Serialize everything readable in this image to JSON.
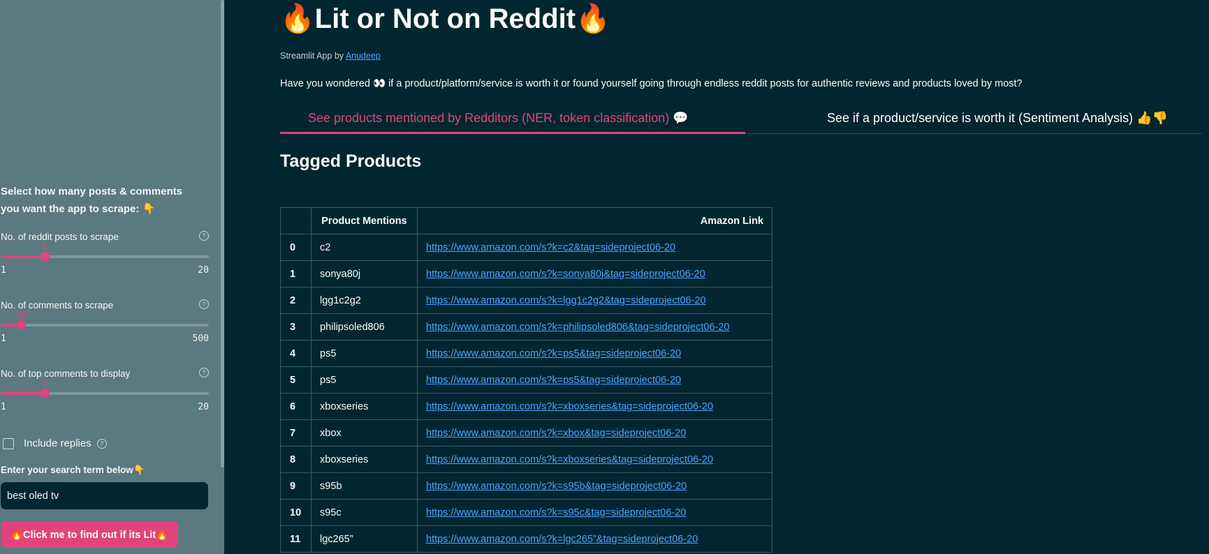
{
  "sidebar": {
    "heading": "Select how many posts & comments you want the app to scrape: 👇",
    "sliders": [
      {
        "label": "No. of reddit posts to scrape",
        "value": "5",
        "min": "1",
        "max": "20"
      },
      {
        "label": "No. of comments to scrape",
        "value": "50",
        "min": "1",
        "max": "500"
      },
      {
        "label": "No. of top comments to display",
        "value": "5",
        "min": "1",
        "max": "20"
      }
    ],
    "help_icon": "?",
    "include_replies_label": "Include replies",
    "include_replies_checked": false,
    "search_label": "Enter your search term below👇",
    "search_value": "best oled tv",
    "button_label": "🔥Click me to find out if its Lit🔥"
  },
  "main": {
    "title": "🔥Lit or Not on Reddit🔥",
    "credit_prefix": "Streamlit App by ",
    "credit_link": "Anudeep",
    "intro": "Have you wondered 👀 if a product/platform/service is worth it or found yourself going through endless reddit posts for authentic reviews and products loved by most?",
    "tabs": [
      {
        "label": "See products mentioned by Redditors (NER, token classification) 💬",
        "active": true
      },
      {
        "label": "See if a product/service is worth it (Sentiment Analysis) 👍👎",
        "active": false
      }
    ],
    "section_title": "Tagged Products",
    "table": {
      "headers": [
        "",
        "Product Mentions",
        "Amazon Link"
      ],
      "rows": [
        {
          "idx": "0",
          "product": "c2",
          "link": "https://www.amazon.com/s?k=c2&tag=sideproject06-20"
        },
        {
          "idx": "1",
          "product": "sonya80j",
          "link": "https://www.amazon.com/s?k=sonya80j&tag=sideproject06-20"
        },
        {
          "idx": "2",
          "product": "lgg1c2g2",
          "link": "https://www.amazon.com/s?k=lgg1c2g2&tag=sideproject06-20"
        },
        {
          "idx": "3",
          "product": "philipsoled806",
          "link": "https://www.amazon.com/s?k=philipsoled806&tag=sideproject06-20"
        },
        {
          "idx": "4",
          "product": "ps5",
          "link": "https://www.amazon.com/s?k=ps5&tag=sideproject06-20"
        },
        {
          "idx": "5",
          "product": "ps5",
          "link": "https://www.amazon.com/s?k=ps5&tag=sideproject06-20"
        },
        {
          "idx": "6",
          "product": "xboxseries",
          "link": "https://www.amazon.com/s?k=xboxseries&tag=sideproject06-20"
        },
        {
          "idx": "7",
          "product": "xbox",
          "link": "https://www.amazon.com/s?k=xbox&tag=sideproject06-20"
        },
        {
          "idx": "8",
          "product": "xboxseries",
          "link": "https://www.amazon.com/s?k=xboxseries&tag=sideproject06-20"
        },
        {
          "idx": "9",
          "product": "s95b",
          "link": "https://www.amazon.com/s?k=s95b&tag=sideproject06-20"
        },
        {
          "idx": "10",
          "product": "s95c",
          "link": "https://www.amazon.com/s?k=s95c&tag=sideproject06-20"
        },
        {
          "idx": "11",
          "product": "lgc265”",
          "link": "https://www.amazon.com/s?k=lgc265”&tag=sideproject06-20"
        }
      ]
    }
  },
  "colors": {
    "accent": "#e0447a",
    "main_bg": "#022631",
    "sidebar_bg": "#5b7980",
    "link": "#4da3ff"
  }
}
